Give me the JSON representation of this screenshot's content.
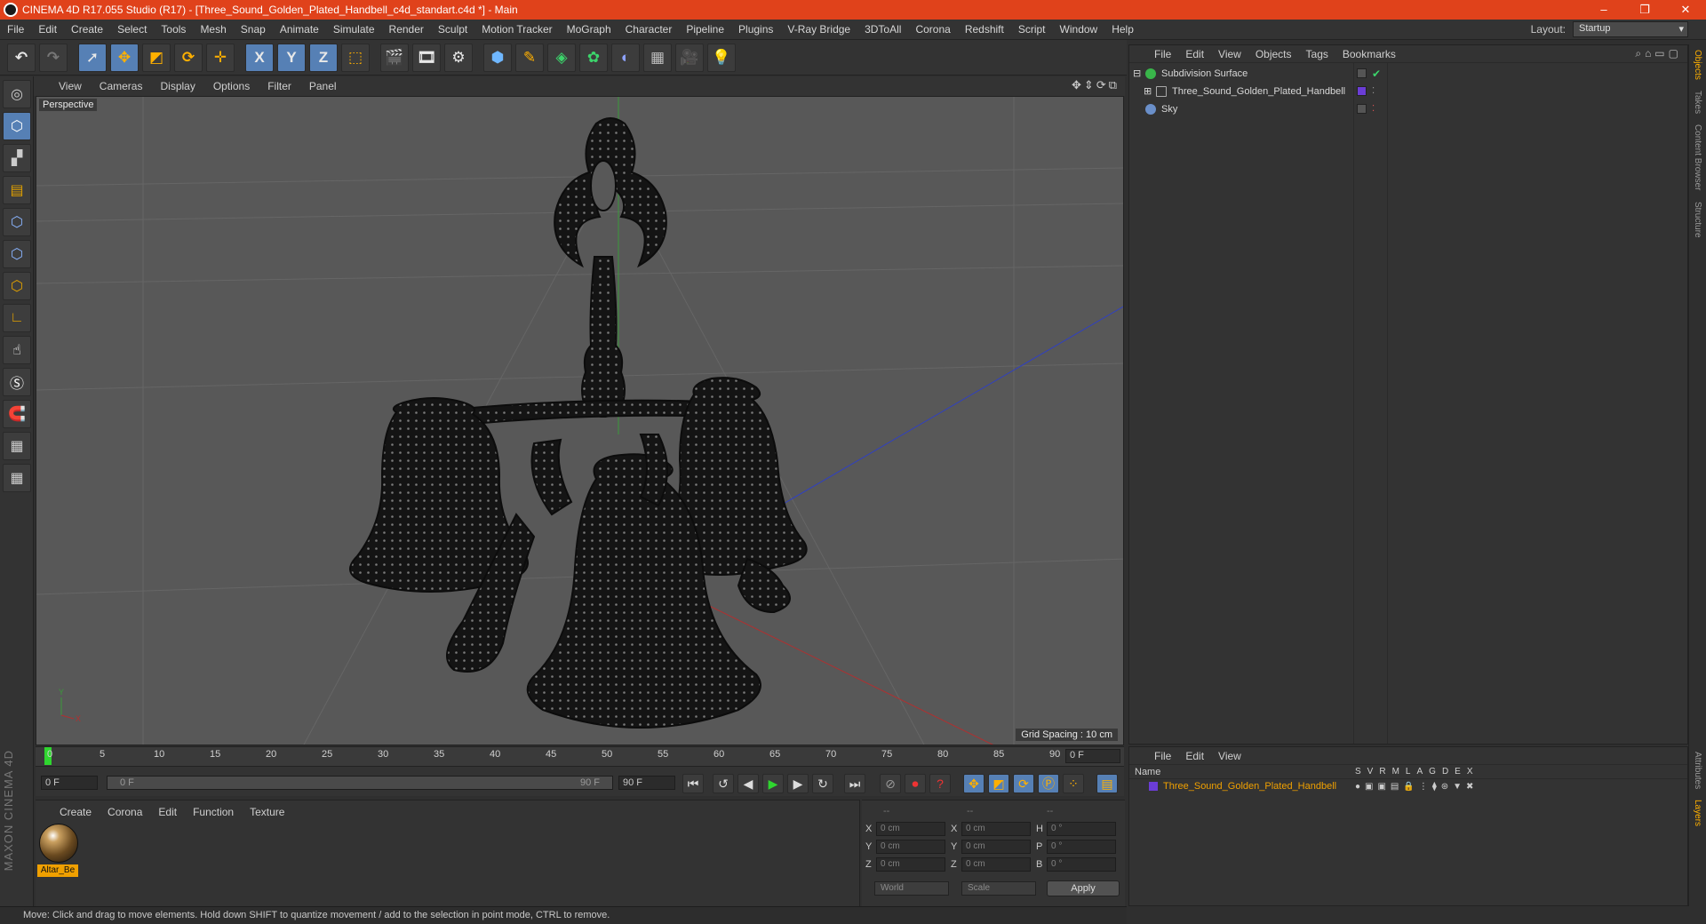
{
  "window": {
    "title": "CINEMA 4D R17.055 Studio (R17) - [Three_Sound_Golden_Plated_Handbell_c4d_standart.c4d *] - Main",
    "controls": [
      "–",
      "❐",
      "✕"
    ]
  },
  "menubar": {
    "items": [
      "File",
      "Edit",
      "Create",
      "Select",
      "Tools",
      "Mesh",
      "Snap",
      "Animate",
      "Simulate",
      "Render",
      "Sculpt",
      "Motion Tracker",
      "MoGraph",
      "Character",
      "Pipeline",
      "Plugins",
      "V-Ray Bridge",
      "3DToAll",
      "Corona",
      "Redshift",
      "Script",
      "Window",
      "Help"
    ],
    "layout_label": "Layout:",
    "layout_value": "Startup"
  },
  "toolbar": {
    "axis_x": "X",
    "axis_y": "Y",
    "axis_z": "Z"
  },
  "viewport": {
    "menu": [
      "View",
      "Cameras",
      "Display",
      "Options",
      "Filter",
      "Panel"
    ],
    "label": "Perspective",
    "grid_spacing": "Grid Spacing : 10 cm"
  },
  "timeline": {
    "ticks": [
      "0",
      "5",
      "10",
      "15",
      "20",
      "25",
      "30",
      "35",
      "40",
      "45",
      "50",
      "55",
      "60",
      "65",
      "70",
      "75",
      "80",
      "85",
      "90"
    ],
    "current_frame": "0 F"
  },
  "transport": {
    "start": "0 F",
    "range_start": "0 F",
    "range_end": "90 F",
    "end": "90 F"
  },
  "material_manager": {
    "menu": [
      "Create",
      "Corona",
      "Edit",
      "Function",
      "Texture"
    ],
    "material_name": "Altar_Be"
  },
  "coordinates": {
    "header": [
      "--",
      "--",
      "--"
    ],
    "rows": [
      {
        "a": "X",
        "av": "0 cm",
        "b": "X",
        "bv": "0 cm",
        "c": "H",
        "cv": "0 °"
      },
      {
        "a": "Y",
        "av": "0 cm",
        "b": "Y",
        "bv": "0 cm",
        "c": "P",
        "cv": "0 °"
      },
      {
        "a": "Z",
        "av": "0 cm",
        "b": "Z",
        "bv": "0 cm",
        "c": "B",
        "cv": "0 °"
      }
    ],
    "space": "World",
    "mode": "Scale",
    "apply": "Apply"
  },
  "object_manager": {
    "menu": [
      "File",
      "Edit",
      "View",
      "Objects",
      "Tags",
      "Bookmarks"
    ],
    "objects": [
      {
        "name": "Subdivision Surface",
        "color": "#39b54a"
      },
      {
        "name": "Three_Sound_Golden_Plated_Handbell",
        "color": "#aaaaaa"
      },
      {
        "name": "Sky",
        "color": "#6a8fc9"
      }
    ]
  },
  "right_tabs": [
    "Objects",
    "Takes",
    "Content Browser",
    "Structure"
  ],
  "right_tabs_lower": [
    "Attributes",
    "Layers"
  ],
  "layer_manager": {
    "menu": [
      "File",
      "Edit",
      "View"
    ],
    "name_header": "Name",
    "columns": [
      "S",
      "V",
      "R",
      "M",
      "L",
      "A",
      "G",
      "D",
      "E",
      "X"
    ],
    "layer_name": "Three_Sound_Golden_Plated_Handbell"
  },
  "status": {
    "text": "Move: Click and drag to move elements. Hold down SHIFT to quantize movement / add to the selection in point mode, CTRL to remove."
  },
  "branding": {
    "maxon": "MAXON CINEMA 4D"
  }
}
